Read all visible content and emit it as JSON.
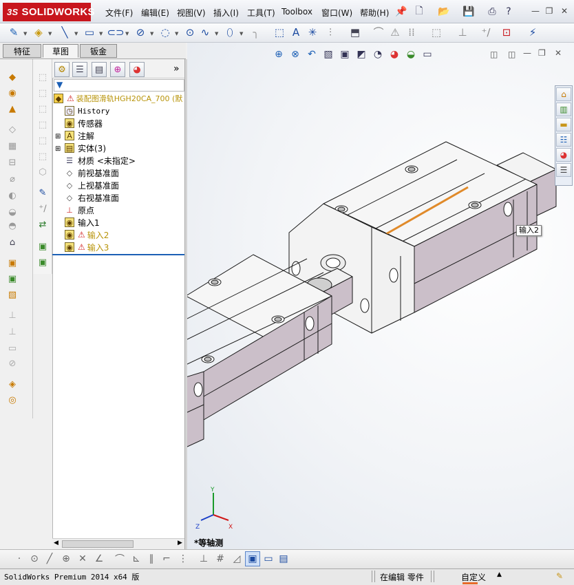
{
  "app": {
    "logo_prefix": "3S",
    "logo_text": "SOLIDWORKS"
  },
  "menu": [
    {
      "label": "文件(F)"
    },
    {
      "label": "编辑(E)"
    },
    {
      "label": "视图(V)"
    },
    {
      "label": "插入(I)"
    },
    {
      "label": "工具(T)"
    },
    {
      "label": "Toolbox"
    },
    {
      "label": "窗口(W)"
    },
    {
      "label": "帮助(H)"
    }
  ],
  "window_buttons": {
    "minimize": "—",
    "restore": "❐",
    "close": "✕"
  },
  "tabs": [
    {
      "label": "特征"
    },
    {
      "label": "草图"
    },
    {
      "label": "钣金"
    }
  ],
  "active_tab": "草图",
  "feature_tree": {
    "root": {
      "label": "装配图滑轨HGH20CA_700 (默"
    },
    "items": [
      {
        "label": "History"
      },
      {
        "label": "传感器"
      },
      {
        "label": "注解"
      },
      {
        "label": "实体(3)"
      },
      {
        "label": "材质 <未指定>"
      },
      {
        "label": "前视基准面"
      },
      {
        "label": "上视基准面"
      },
      {
        "label": "右视基准面"
      },
      {
        "label": "原点"
      },
      {
        "label": "输入1"
      },
      {
        "label": "输入2"
      },
      {
        "label": "输入3"
      }
    ]
  },
  "viewport": {
    "tooltip": "输入2",
    "view_label": "*等轴测",
    "triad": {
      "x": "X",
      "y": "Y",
      "z": "Z"
    }
  },
  "status": {
    "product": "SolidWorks Premium 2014 x64 版",
    "mode": "在编辑 零件",
    "units": "自定义"
  },
  "colors": {
    "accent": "#c8161d",
    "rail_side": "#cbbfc9",
    "rail_top": "#f4f4f4",
    "stripe": "#e08a2a",
    "warning": "#e8b400"
  }
}
